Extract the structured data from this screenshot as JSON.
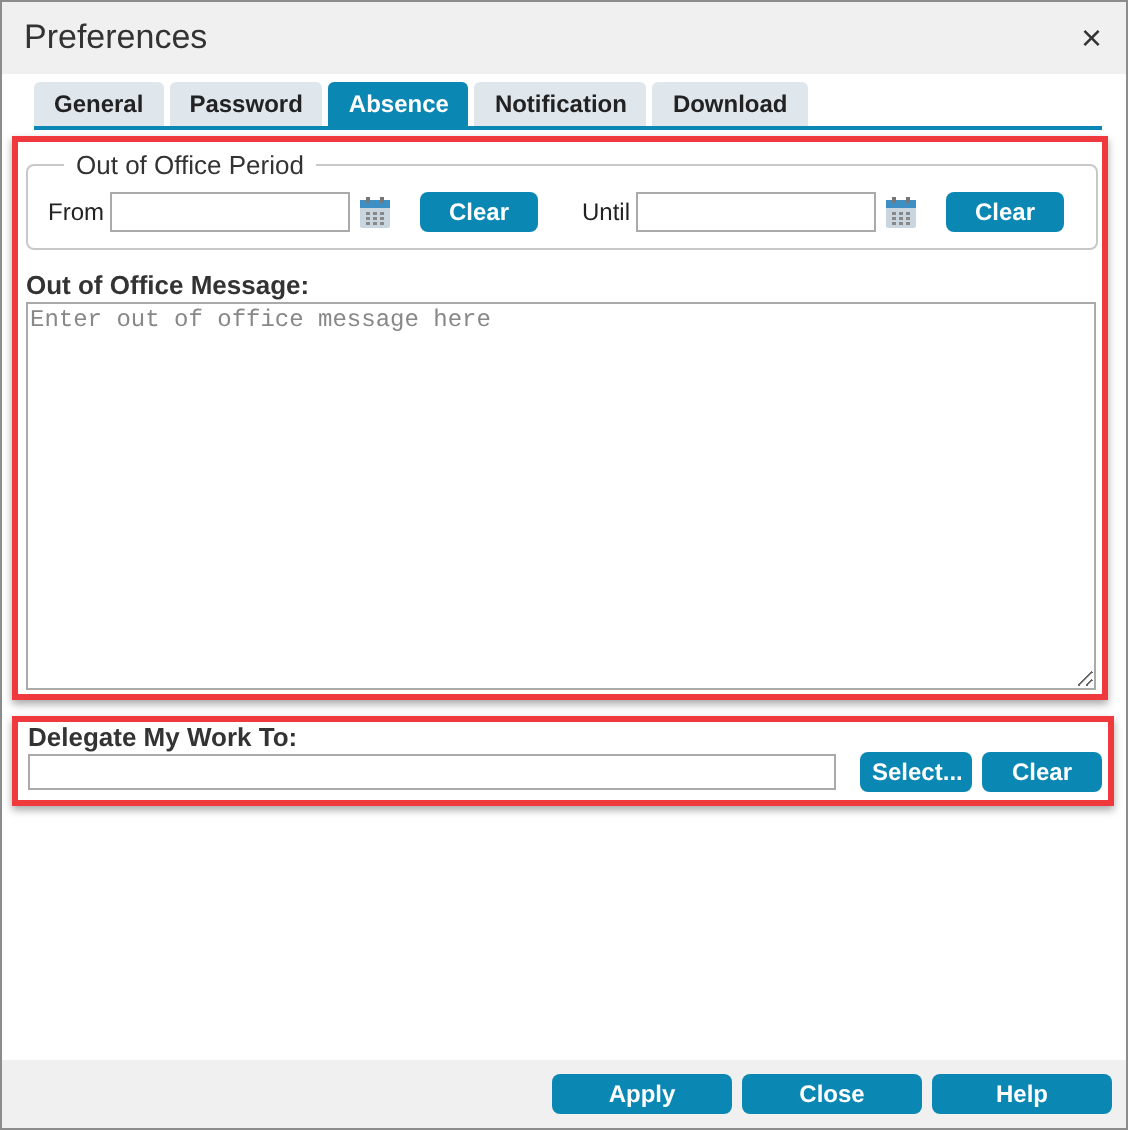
{
  "window": {
    "title": "Preferences",
    "close_glyph": "×"
  },
  "tabs": [
    {
      "label": "General",
      "selected": false
    },
    {
      "label": "Password",
      "selected": false
    },
    {
      "label": "Absence",
      "selected": true
    },
    {
      "label": "Notification",
      "selected": false
    },
    {
      "label": "Download",
      "selected": false
    }
  ],
  "period": {
    "legend": "Out of Office Period",
    "from_label": "From",
    "from_clear_label": "Clear",
    "until_label": "Until",
    "until_clear_label": "Clear"
  },
  "message": {
    "label": "Out of Office Message:",
    "placeholder": "Enter out of office message here"
  },
  "delegate": {
    "label": "Delegate My Work To:",
    "select_label": "Select...",
    "clear_label": "Clear"
  },
  "footer_buttons": [
    "Apply",
    "Close",
    "Help"
  ]
}
